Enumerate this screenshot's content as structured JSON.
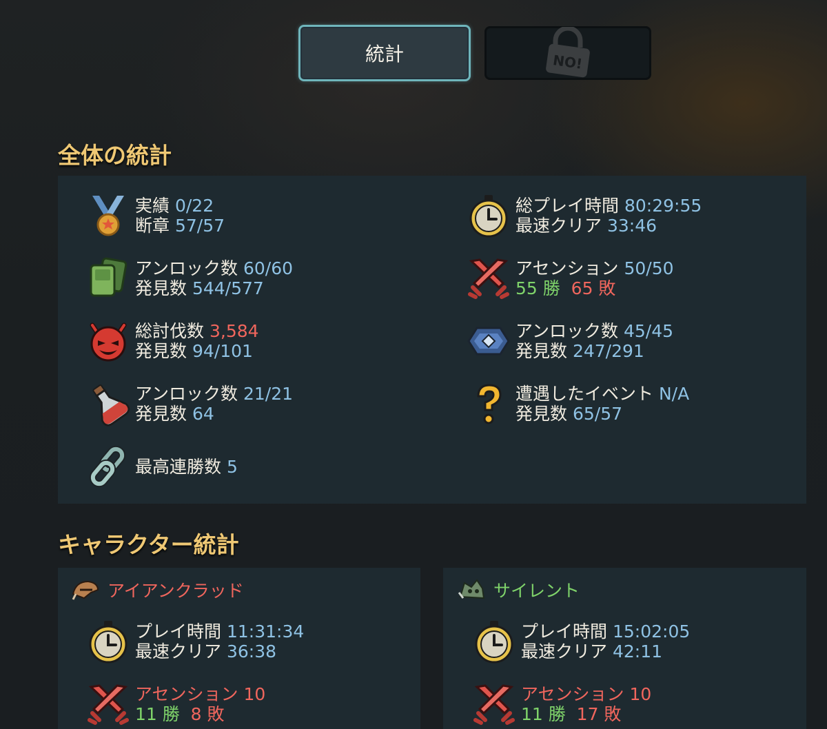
{
  "tabs": {
    "stats_label": "統計",
    "locked_label": "NO!"
  },
  "overall": {
    "title": "全体の統計",
    "achievements": {
      "label": "実績",
      "value": "0/22"
    },
    "fragments": {
      "label": "断章",
      "value": "57/57"
    },
    "total_playtime": {
      "label": "総プレイ時間",
      "value": "80:29:55"
    },
    "fastest_clear": {
      "label": "最速クリア",
      "value": "33:46"
    },
    "cards_unlocked": {
      "label": "アンロック数",
      "value": "60/60"
    },
    "cards_discovered": {
      "label": "発見数",
      "value": "544/577"
    },
    "ascension": {
      "label": "アセンション",
      "value": "50/50"
    },
    "wins": "55 勝",
    "losses": "65 敗",
    "total_kills": {
      "label": "総討伐数",
      "value": "3,584"
    },
    "monsters_discovered": {
      "label": "発見数",
      "value": "94/101"
    },
    "relics_unlocked": {
      "label": "アンロック数",
      "value": "45/45"
    },
    "relics_discovered": {
      "label": "発見数",
      "value": "247/291"
    },
    "potions_unlocked": {
      "label": "アンロック数",
      "value": "21/21"
    },
    "potions_discovered": {
      "label": "発見数",
      "value": "64"
    },
    "events_encountered": {
      "label": "遭遇したイベント",
      "value": "N/A"
    },
    "events_discovered": {
      "label": "発見数",
      "value": "65/57"
    },
    "best_streak": {
      "label": "最高連勝数",
      "value": "5"
    }
  },
  "characters": {
    "title": "キャラクター統計",
    "list": [
      {
        "name": "アイアンクラッド",
        "name_color": "#f0665d",
        "playtime": {
          "label": "プレイ時間",
          "value": "11:31:34"
        },
        "fastest": {
          "label": "最速クリア",
          "value": "36:38"
        },
        "ascension": {
          "label": "アセンション",
          "value": "10"
        },
        "wins": "11 勝",
        "losses": "8 敗"
      },
      {
        "name": "サイレント",
        "name_color": "#7fd36a",
        "playtime": {
          "label": "プレイ時間",
          "value": "15:02:05"
        },
        "fastest": {
          "label": "最速クリア",
          "value": "42:11"
        },
        "ascension": {
          "label": "アセンション",
          "value": "10"
        },
        "wins": "11 勝",
        "losses": "17 敗"
      }
    ]
  },
  "icons": {
    "medal": "medal-icon",
    "stopwatch": "stopwatch-icon",
    "cards": "cards-icon",
    "crossed_swords": "crossed-swords-icon",
    "demon": "demon-face-icon",
    "relic": "relic-gem-icon",
    "potion": "potion-icon",
    "question": "question-mark-icon",
    "chain": "chain-link-icon",
    "ironclad": "ironclad-helmet-icon",
    "silent": "silent-skull-icon"
  }
}
